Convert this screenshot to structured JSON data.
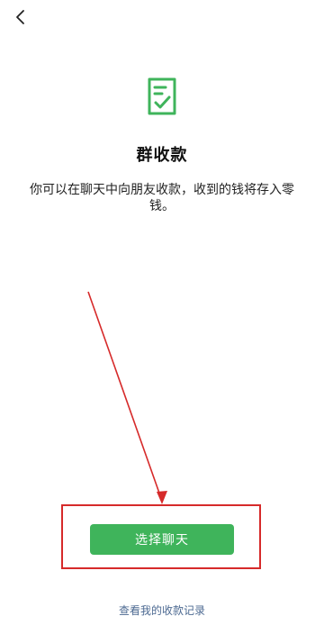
{
  "nav": {
    "back_icon": "chevron-left-icon"
  },
  "hero": {
    "icon": "receipt-check-icon",
    "title": "群收款",
    "description": "你可以在聊天中向朋友收款，收到的钱将存入零钱。"
  },
  "actions": {
    "select_chat_label": "选择聊天",
    "records_link_label": "查看我的收款记录"
  },
  "colors": {
    "accent_green": "#3fb45b",
    "annotation_red": "#d62a2a",
    "link_blue": "#4d6a92"
  }
}
